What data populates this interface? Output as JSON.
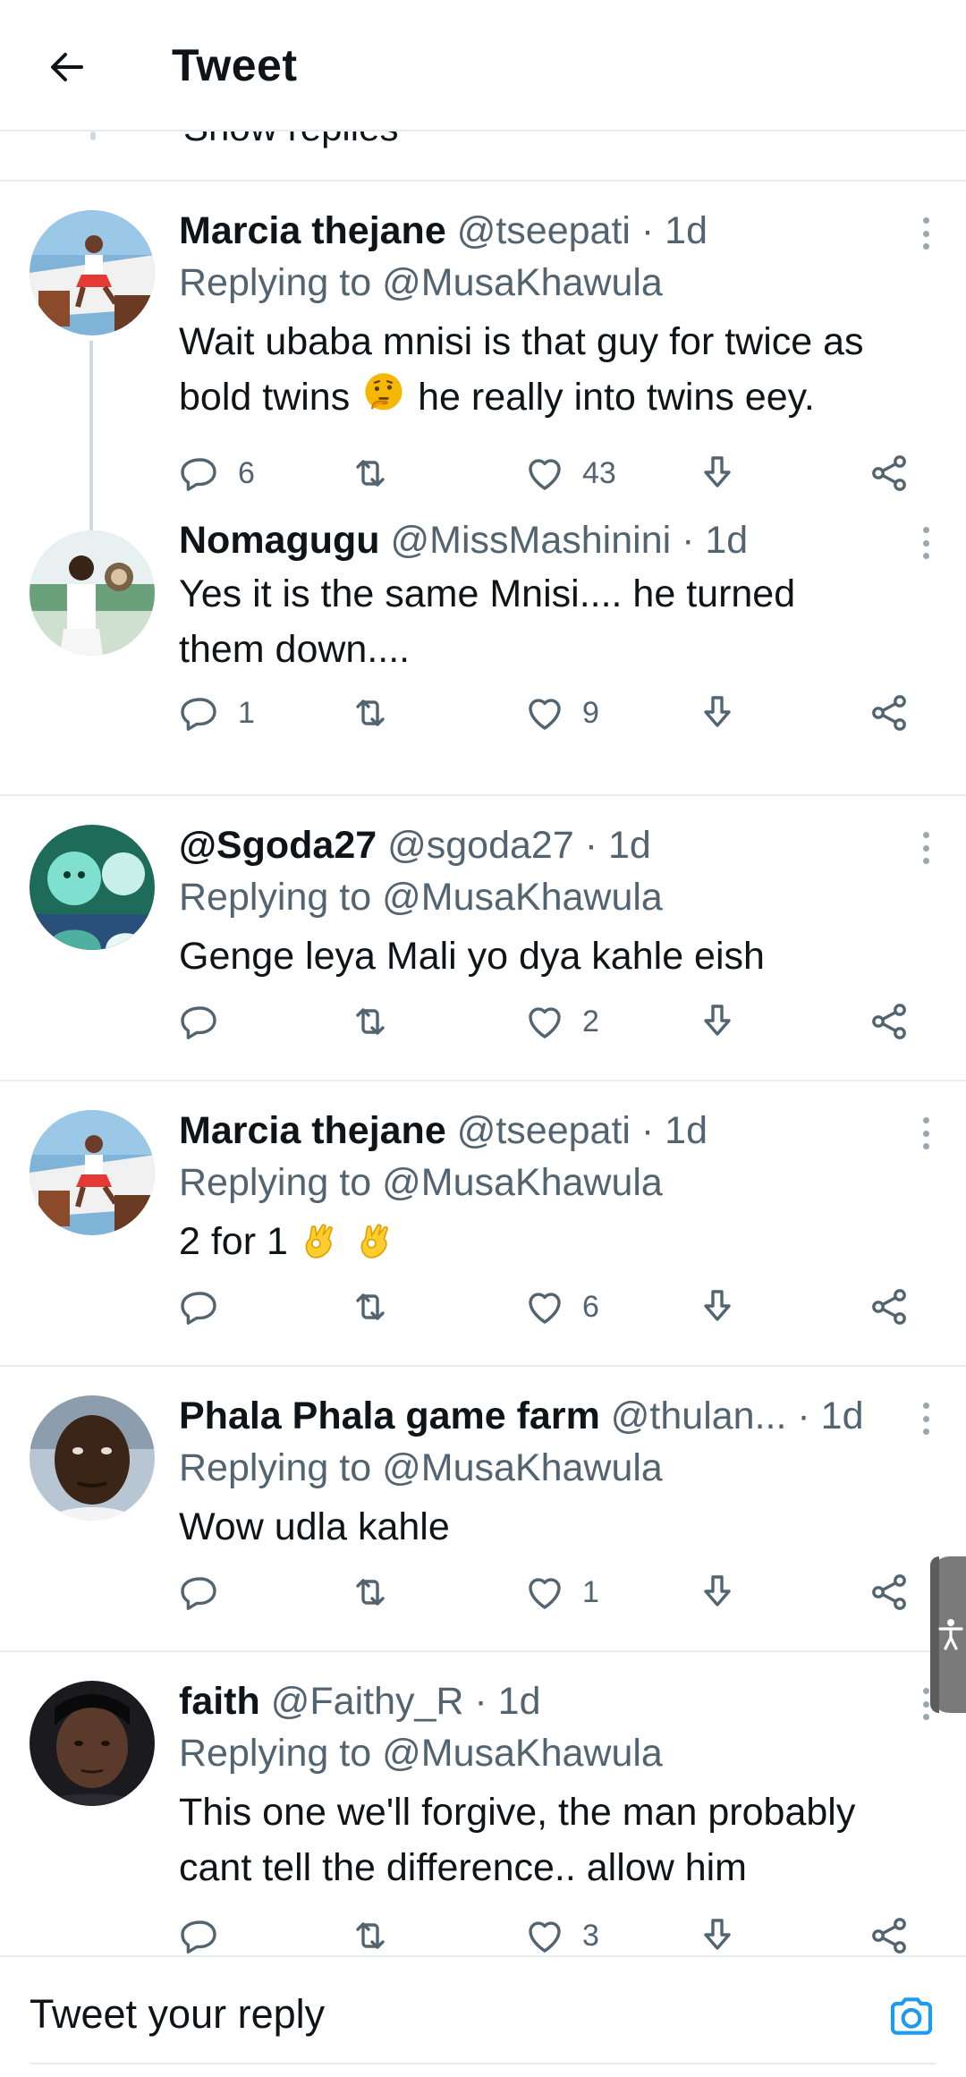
{
  "header": {
    "title": "Tweet"
  },
  "partial": {
    "text": "Show replies"
  },
  "tweets": [
    {
      "name": "Marcia thejane",
      "handle": "@tseepati",
      "time": "· 1d",
      "replying_label": "Replying to",
      "replying_to": "@MusaKhawula",
      "text_lines": [
        "Wait ubaba mnisi is that guy for twice as",
        "bold twins",
        "he really into twins eey."
      ],
      "counts": {
        "replies": "6",
        "retweets": "",
        "likes": "43"
      }
    },
    {
      "name": "Nomagugu",
      "handle": "@MissMashinini",
      "time": "· 1d",
      "text_lines": [
        "Yes it is the same Mnisi.... he turned",
        "them down...."
      ],
      "counts": {
        "replies": "1",
        "retweets": "",
        "likes": "9"
      }
    },
    {
      "name": "@Sgoda27",
      "handle": "@sgoda27",
      "time": "· 1d",
      "replying_label": "Replying to",
      "replying_to": "@MusaKhawula",
      "text_lines": [
        "Genge leya Mali yo dya kahle eish"
      ],
      "counts": {
        "replies": "",
        "retweets": "",
        "likes": "2"
      }
    },
    {
      "name": "Marcia thejane",
      "handle": "@tseepati",
      "time": "· 1d",
      "replying_label": "Replying to",
      "replying_to": "@MusaKhawula",
      "text_lines": [
        "2 for 1"
      ],
      "counts": {
        "replies": "",
        "retweets": "",
        "likes": "6"
      }
    },
    {
      "name": "Phala Phala game farm",
      "handle": "@thulan...",
      "time": "· 1d",
      "replying_label": "Replying to",
      "replying_to": "@MusaKhawula",
      "text_lines": [
        "Wow udla kahle"
      ],
      "counts": {
        "replies": "",
        "retweets": "",
        "likes": "1"
      }
    },
    {
      "name": "faith",
      "handle": "@Faithy_R",
      "time": "· 1d",
      "replying_label": "Replying to",
      "replying_to": "@MusaKhawula",
      "text_lines": [
        "This one we'll forgive, the man probably",
        "cant tell the difference.. allow him"
      ],
      "counts": {
        "replies": "",
        "retweets": "",
        "likes": "3"
      }
    }
  ],
  "reply_bar": {
    "placeholder": "Tweet your reply"
  },
  "icons": {
    "back": "arrow-left-icon",
    "more": "more-vertical-icon",
    "reply": "reply-icon",
    "retweet": "retweet-icon",
    "like": "heart-icon",
    "download": "download-icon",
    "share": "share-icon",
    "camera": "camera-icon",
    "accessibility": "accessibility-icon",
    "emoji_thinking": "thinking-face-emoji",
    "emoji_ok": "ok-hand-emoji"
  },
  "colors": {
    "accent": "#1d9bf0",
    "text": "#0f1419",
    "secondary": "#536471",
    "divider": "#e6ecf0"
  }
}
